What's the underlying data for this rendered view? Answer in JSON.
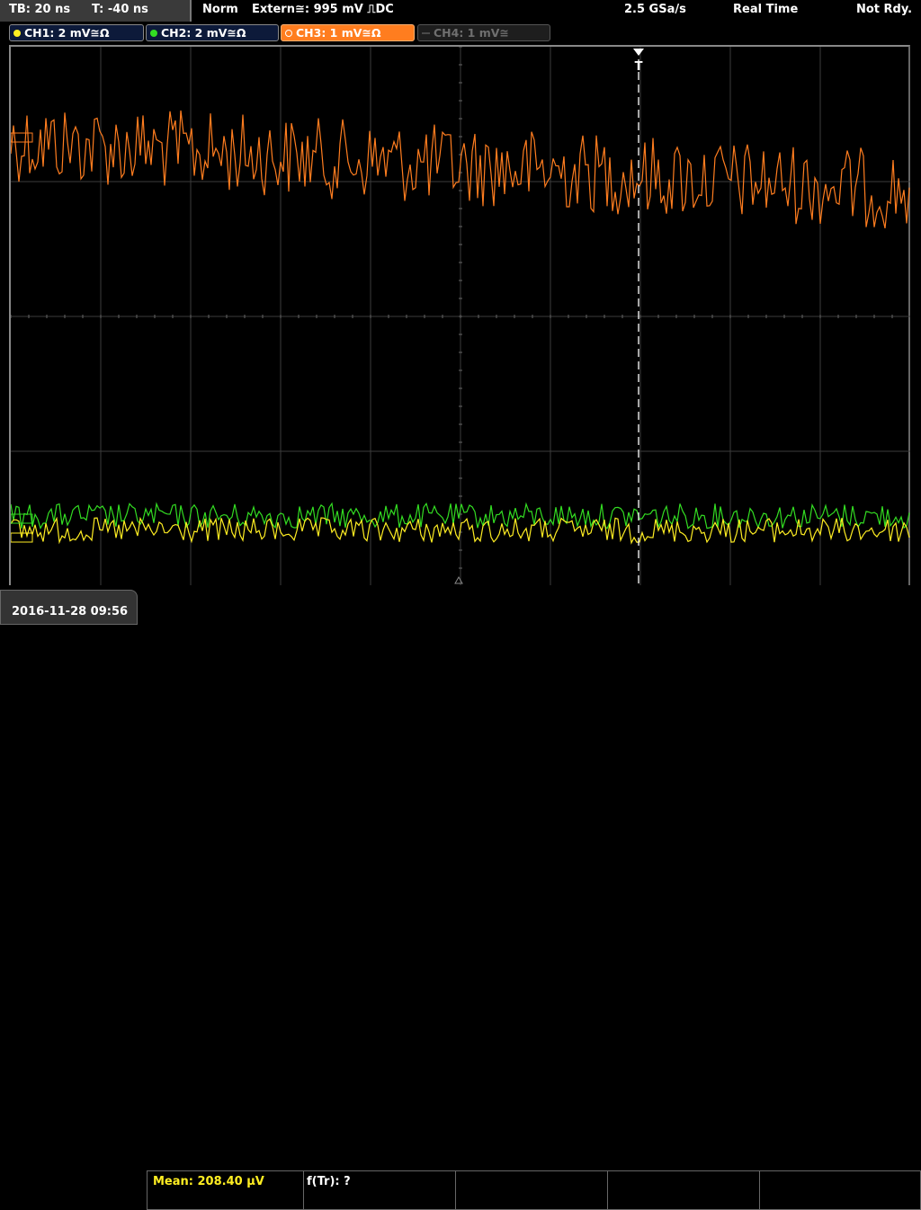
{
  "header": {
    "timebase": "TB: 20 ns",
    "trigger_time": "T: -40 ns",
    "mode": "Norm",
    "trigger_source": "Extern≅: 995 mV ⎍DC",
    "sample_rate": "2.5 GSa/s",
    "acq_mode": "Real Time",
    "status": "Not Rdy."
  },
  "channels": [
    {
      "label": "CH1: 2 mV≅Ω",
      "color": "#ffee22"
    },
    {
      "label": "CH2: 2 mV≅Ω",
      "color": "#33dd22"
    },
    {
      "label": "CH3: 1 mV≅Ω",
      "color": "#ff7d1f"
    },
    {
      "label": "CH4: 1 mV≅",
      "color": "#6f6f6f"
    }
  ],
  "trigger_marker": "T",
  "footer": {
    "datetime": "2016-11-28 09:56",
    "measurement1": "Mean: 208.40 µV",
    "measurement2": "f(Tr): ?"
  },
  "colors": {
    "ch1": "#ffee22",
    "ch2": "#33dd22",
    "ch3": "#ff7d1f",
    "grid": "#3c3c3c"
  }
}
